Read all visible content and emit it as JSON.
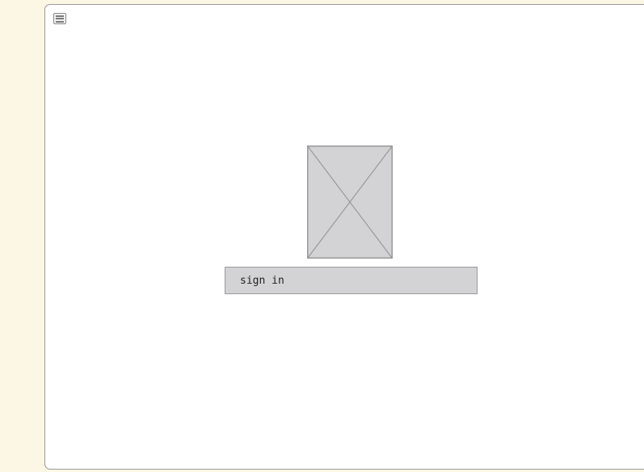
{
  "menu": {
    "icon": "hamburger-menu-icon"
  },
  "placeholder": {
    "icon": "image-placeholder-icon"
  },
  "signin": {
    "label": "sign in"
  },
  "colors": {
    "page_background": "#fbf7e4",
    "canvas_background": "#ffffff",
    "button_fill": "#d3d3d5",
    "placeholder_fill": "#d3d3d5",
    "border": "#9a9a9a"
  }
}
